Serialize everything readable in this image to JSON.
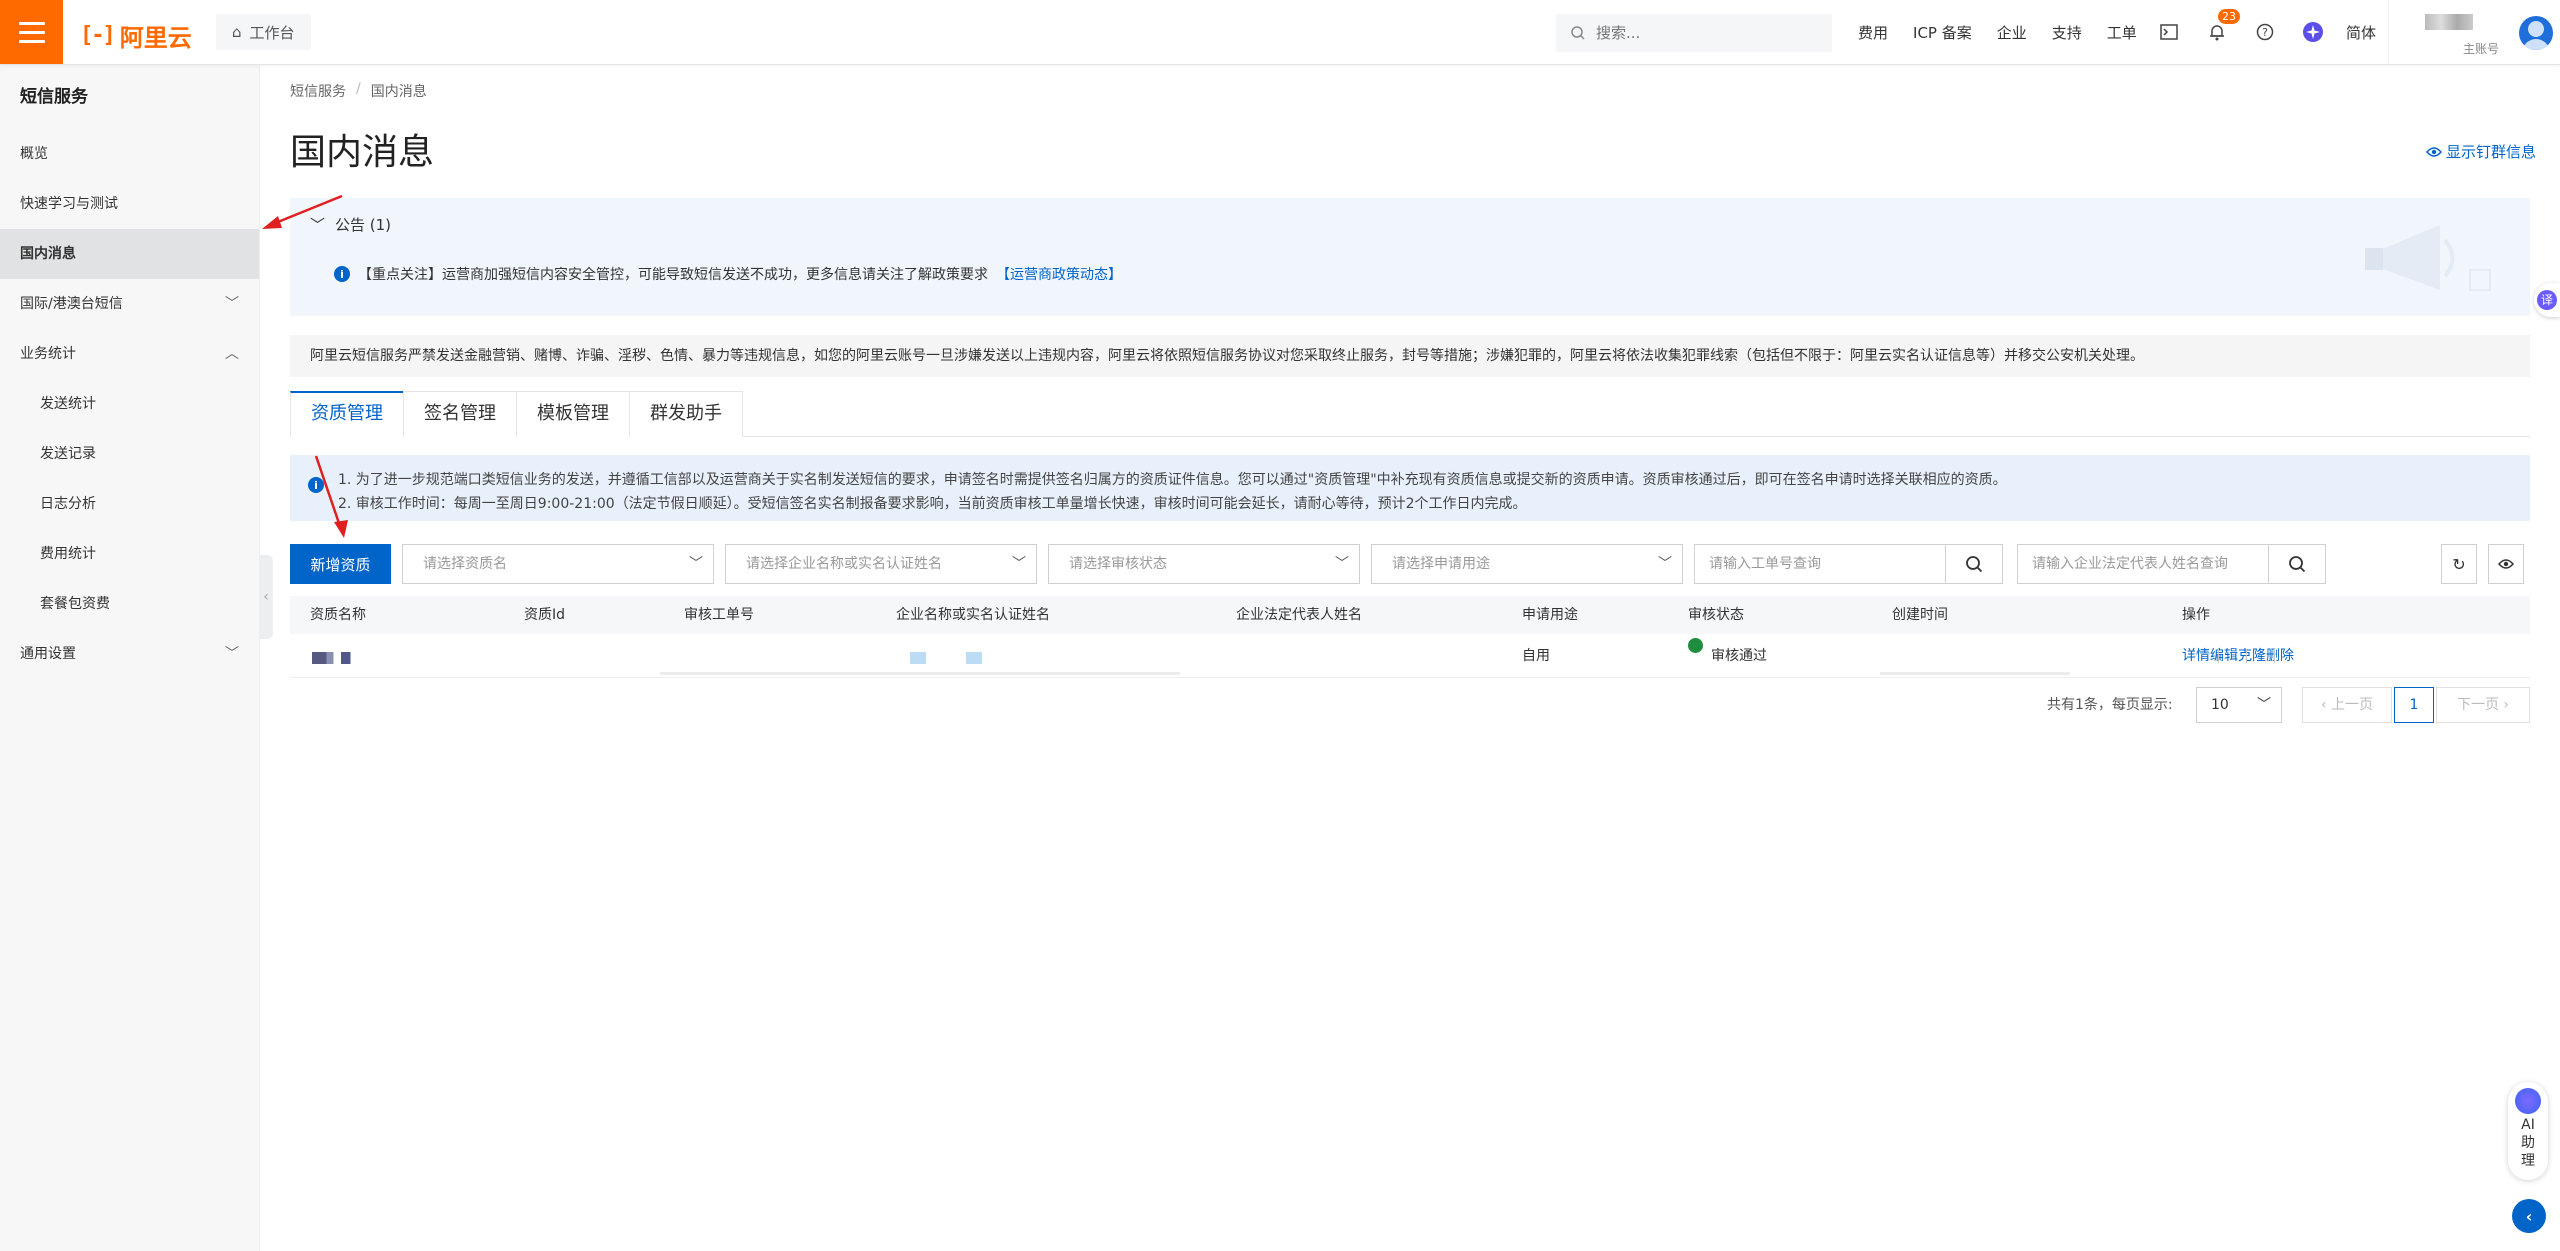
{
  "topbar": {
    "logo_text": "阿里云",
    "logo_mark": "[-]",
    "workbench_label": "工作台",
    "search_placeholder": "搜索...",
    "nav_links": [
      "费用",
      "ICP 备案",
      "企业",
      "支持",
      "工单"
    ],
    "notification_count": "23",
    "language": "简体",
    "account_sub": "主账号"
  },
  "sidebar": {
    "title": "短信服务",
    "items": [
      {
        "label": "概览"
      },
      {
        "label": "快速学习与测试"
      },
      {
        "label": "国内消息"
      },
      {
        "label": "国际/港澳台短信"
      },
      {
        "label": "业务统计"
      },
      {
        "label": "发送统计"
      },
      {
        "label": "发送记录"
      },
      {
        "label": "日志分析"
      },
      {
        "label": "费用统计"
      },
      {
        "label": "套餐包资费"
      },
      {
        "label": "通用设置"
      }
    ]
  },
  "breadcrumb": [
    "短信服务",
    "国内消息"
  ],
  "page_title": "国内消息",
  "ding_link": "显示钉群信息",
  "notice": {
    "header": "公告 (1)",
    "body": "【重点关注】运营商加强短信内容安全管控，可能导致短信发送不成功，更多信息请关注了解政策要求",
    "link": "【运营商政策动态】"
  },
  "warning_text": "阿里云短信服务严禁发送金融营销、赌博、诈骗、淫秽、色情、暴力等违规信息，如您的阿里云账号一旦涉嫌发送以上违规内容，阿里云将依照短信服务协议对您采取终止服务，封号等措施；涉嫌犯罪的，阿里云将依法收集犯罪线索（包括但不限于：阿里云实名认证信息等）并移交公安机关处理。",
  "tabs": [
    "资质管理",
    "签名管理",
    "模板管理",
    "群发助手"
  ],
  "tips": [
    "1. 为了进一步规范端口类短信业务的发送，并遵循工信部以及运营商关于实名制发送短信的要求，申请签名时需提供签名归属方的资质证件信息。您可以通过\"资质管理\"中补充现有资质信息或提交新的资质申请。资质审核通过后，即可在签名申请时选择关联相应的资质。",
    "2. 审核工作时间：每周一至周日9:00-21:00（法定节假日顺延）。受短信签名实名制报备要求影响，当前资质审核工单量增长快速，审核时间可能会延长，请耐心等待，预计2个工作日内完成。"
  ],
  "toolbar": {
    "add_button": "新增资质",
    "selects": [
      "请选择资质名",
      "请选择企业名称或实名认证姓名",
      "请选择审核状态",
      "请选择申请用途"
    ],
    "ticket_placeholder": "请输入工单号查询",
    "legal_placeholder": "请输入企业法定代表人姓名查询"
  },
  "table": {
    "headers": [
      "资质名称",
      "资质Id",
      "审核工单号",
      "企业名称或实名认证姓名",
      "企业法定代表人姓名",
      "申请用途",
      "审核状态",
      "创建时间",
      "操作"
    ],
    "rows": [
      {
        "usage": "自用",
        "status": "审核通过",
        "actions": [
          "详情",
          "编辑",
          "克隆",
          "删除"
        ]
      }
    ]
  },
  "pagination": {
    "total_text": "共有1条，每页显示:",
    "page_size": "10",
    "prev": "上一页",
    "current": "1",
    "next": "下一页"
  },
  "floating": {
    "translate": "译",
    "ai_label": "AI助理"
  },
  "colors": {
    "brand": "#ff6a00",
    "primary": "#0064c8",
    "success": "#1e8e3e",
    "annotation": "#e02020"
  }
}
